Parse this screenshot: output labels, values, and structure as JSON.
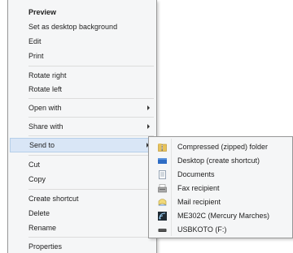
{
  "context_menu": {
    "items": [
      {
        "label": "Preview"
      },
      {
        "label": "Set as desktop background"
      },
      {
        "label": "Edit"
      },
      {
        "label": "Print"
      },
      {
        "label": "Rotate right"
      },
      {
        "label": "Rotate left"
      },
      {
        "label": "Open with"
      },
      {
        "label": "Share with"
      },
      {
        "label": "Send to"
      },
      {
        "label": "Cut"
      },
      {
        "label": "Copy"
      },
      {
        "label": "Create shortcut"
      },
      {
        "label": "Delete"
      },
      {
        "label": "Rename"
      },
      {
        "label": "Properties"
      }
    ]
  },
  "send_to_menu": {
    "items": [
      {
        "label": "Compressed (zipped) folder",
        "icon": "zip-folder-icon"
      },
      {
        "label": "Desktop (create shortcut)",
        "icon": "desktop-icon"
      },
      {
        "label": "Documents",
        "icon": "documents-icon"
      },
      {
        "label": "Fax recipient",
        "icon": "fax-icon"
      },
      {
        "label": "Mail recipient",
        "icon": "mail-icon"
      },
      {
        "label": "ME302C (Mercury Marches)",
        "icon": "device-icon"
      },
      {
        "label": "USBKOTO (F:)",
        "icon": "usb-drive-icon"
      }
    ]
  },
  "colors": {
    "highlight": "#d9e6f6",
    "highlight_border": "#b5cfe9",
    "menu_background": "#f5f6f7"
  }
}
